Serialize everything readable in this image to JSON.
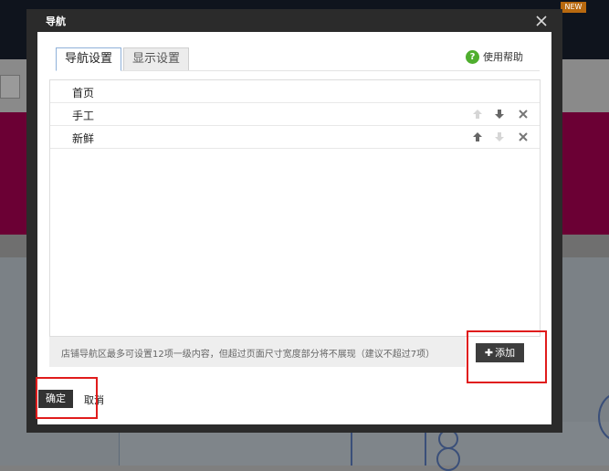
{
  "background": {
    "badge": "NEW"
  },
  "dialog": {
    "title": "导航",
    "close_icon": "close-icon",
    "tabs": [
      {
        "label": "导航设置",
        "active": true
      },
      {
        "label": "显示设置",
        "active": false
      }
    ],
    "help_label": "使用帮助",
    "help_icon": "question-circle-icon",
    "nav_items": [
      {
        "label": "首页",
        "actions": []
      },
      {
        "label": "手工",
        "actions": [
          "arrow-up-icon",
          "arrow-down-icon",
          "delete-icon"
        ],
        "up_enabled": false,
        "down_enabled": true
      },
      {
        "label": "新鲜",
        "actions": [
          "arrow-up-icon",
          "arrow-down-icon",
          "delete-icon"
        ],
        "up_enabled": true,
        "down_enabled": false
      }
    ],
    "footer_note": "店铺导航区最多可设置12项一级内容，但超过页面尺寸宽度部分将不展现（建议不超过7项）",
    "add_button": {
      "plus": "✚",
      "label": "添加"
    },
    "confirm_label": "确定",
    "cancel_label": "取消"
  },
  "colors": {
    "highlight": "#e01c1c",
    "help_green": "#4fae2e",
    "background_pink": "#6b0034",
    "dialog_frame": "#2b2b2b"
  }
}
